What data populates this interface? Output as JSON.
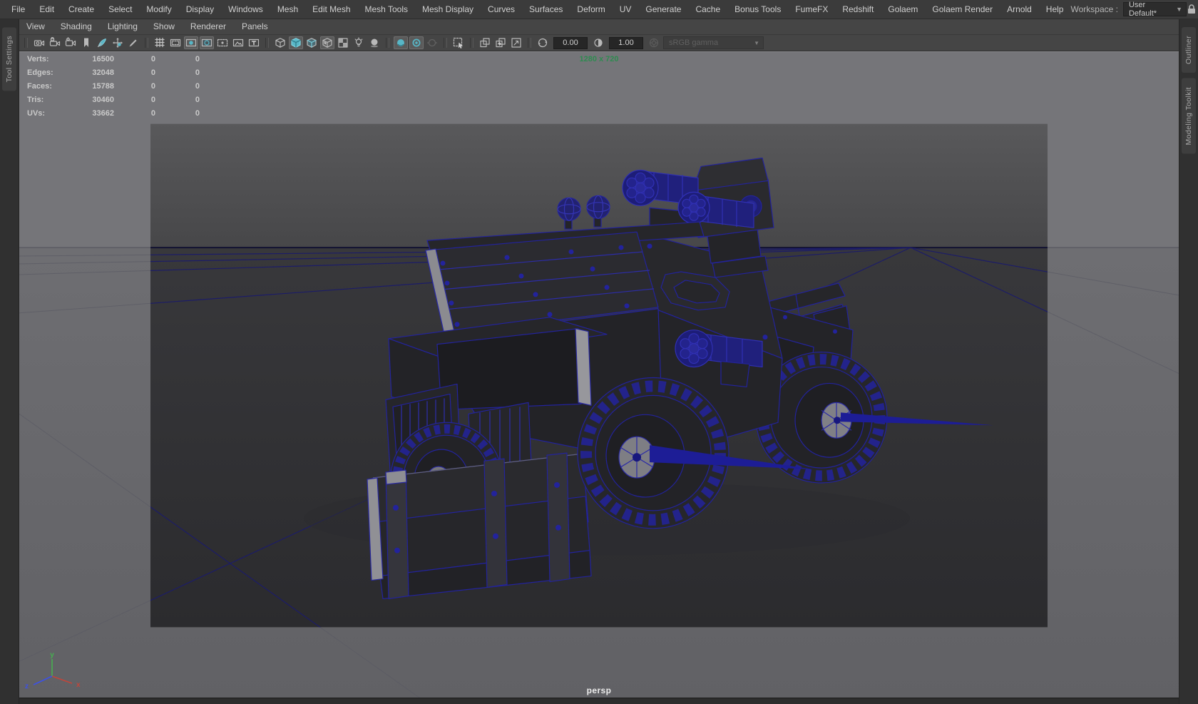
{
  "window": {
    "workspace_label": "Workspace :",
    "workspace_value": "User Default*",
    "lock_icon": "lock-icon"
  },
  "menubar": {
    "items": [
      "File",
      "Edit",
      "Create",
      "Select",
      "Modify",
      "Display",
      "Windows",
      "Mesh",
      "Edit Mesh",
      "Mesh Tools",
      "Mesh Display",
      "Curves",
      "Surfaces",
      "Deform",
      "UV",
      "Generate",
      "Cache",
      "Bonus Tools",
      "FumeFX",
      "Redshift",
      "Golaem",
      "Golaem Render",
      "Arnold",
      "Help"
    ]
  },
  "panel_menus": {
    "items": [
      "View",
      "Shading",
      "Lighting",
      "Show",
      "Renderer",
      "Panels"
    ]
  },
  "toolbar": {
    "icons": [
      {
        "type": "sep"
      },
      {
        "type": "icon",
        "name": "select-camera-icon",
        "kind": "camsel",
        "state": "normal"
      },
      {
        "type": "icon",
        "name": "lock-camera-icon",
        "kind": "camlock",
        "state": "normal"
      },
      {
        "type": "icon",
        "name": "camera-attributes-icon",
        "kind": "camgear",
        "state": "normal"
      },
      {
        "type": "icon",
        "name": "bookmark-icon",
        "kind": "bookmark",
        "state": "normal"
      },
      {
        "type": "icon",
        "name": "image-plane-icon",
        "kind": "quill",
        "state": "normal"
      },
      {
        "type": "icon",
        "name": "pan-zoom-2d-icon",
        "kind": "pan2d",
        "state": "normal"
      },
      {
        "type": "icon",
        "name": "grease-pencil-icon",
        "kind": "pencil",
        "state": "normal"
      },
      {
        "type": "sep"
      },
      {
        "type": "icon",
        "name": "grid-icon",
        "kind": "grid",
        "state": "normal"
      },
      {
        "type": "icon",
        "name": "film-gate-icon",
        "kind": "filmgate",
        "state": "normal"
      },
      {
        "type": "icon",
        "name": "resolution-gate-icon",
        "kind": "resgate",
        "state": "active"
      },
      {
        "type": "icon",
        "name": "gate-mask-icon",
        "kind": "gatemask",
        "state": "active"
      },
      {
        "type": "icon",
        "name": "field-chart-icon",
        "kind": "fieldchart",
        "state": "normal"
      },
      {
        "type": "icon",
        "name": "safe-action-icon",
        "kind": "safeaction",
        "state": "normal"
      },
      {
        "type": "icon",
        "name": "safe-title-icon",
        "kind": "safetitle",
        "state": "normal"
      },
      {
        "type": "sep"
      },
      {
        "type": "icon",
        "name": "wireframe-icon",
        "kind": "cubewire",
        "state": "normal"
      },
      {
        "type": "icon",
        "name": "smooth-shade-icon",
        "kind": "cubeshaded",
        "state": "active"
      },
      {
        "type": "icon",
        "name": "wireframe-on-shaded-icon",
        "kind": "cubehalf",
        "state": "normal"
      },
      {
        "type": "icon",
        "name": "textured-icon",
        "kind": "cubetex",
        "state": "active"
      },
      {
        "type": "icon",
        "name": "use-default-material-icon",
        "kind": "checker",
        "state": "normal"
      },
      {
        "type": "icon",
        "name": "lighting-icon",
        "kind": "bulb",
        "state": "normal"
      },
      {
        "type": "icon",
        "name": "shadows-icon",
        "kind": "sphshadow",
        "state": "normal"
      },
      {
        "type": "sep"
      },
      {
        "type": "icon",
        "name": "ambient-occlusion-icon",
        "kind": "ao",
        "state": "active"
      },
      {
        "type": "icon",
        "name": "anti-aliasing-icon",
        "kind": "aa",
        "state": "active"
      },
      {
        "type": "icon",
        "name": "depth-of-field-icon",
        "kind": "dofdim",
        "state": "dim"
      },
      {
        "type": "sep"
      },
      {
        "type": "icon",
        "name": "isolate-select-icon",
        "kind": "isolate",
        "state": "normal"
      },
      {
        "type": "sep"
      },
      {
        "type": "icon",
        "name": "snapshot-icon",
        "kind": "layers",
        "state": "normal"
      },
      {
        "type": "icon",
        "name": "scene-capture-icon",
        "kind": "layersgo",
        "state": "normal"
      },
      {
        "type": "icon",
        "name": "render-region-icon",
        "kind": "regionarrow",
        "state": "normal"
      },
      {
        "type": "sep"
      },
      {
        "type": "icon",
        "name": "exposure-icon",
        "kind": "aperture",
        "state": "normal"
      },
      {
        "type": "field",
        "name": "exposure-field",
        "value": "0.00"
      },
      {
        "type": "icon",
        "name": "contrast-icon",
        "kind": "contrast",
        "state": "normal"
      },
      {
        "type": "field",
        "name": "gamma-field",
        "value": "1.00"
      },
      {
        "type": "icon",
        "name": "color-management-icon",
        "kind": "cmdim",
        "state": "dim"
      },
      {
        "type": "dropdown",
        "name": "colorspace-select",
        "value": "sRGB gamma"
      }
    ]
  },
  "hud": {
    "rows": [
      {
        "label": "Verts:",
        "total": "16500",
        "sel": "0",
        "sel2": "0"
      },
      {
        "label": "Edges:",
        "total": "32048",
        "sel": "0",
        "sel2": "0"
      },
      {
        "label": "Faces:",
        "total": "15788",
        "sel": "0",
        "sel2": "0"
      },
      {
        "label": "Tris:",
        "total": "30460",
        "sel": "0",
        "sel2": "0"
      },
      {
        "label": "UVs:",
        "total": "33662",
        "sel": "0",
        "sel2": "0"
      }
    ],
    "gate_resolution": "1280 x 720"
  },
  "viewport": {
    "camera_label": "persp"
  },
  "side_tabs": {
    "left": [
      "Tool Settings"
    ],
    "right": [
      "Outliner",
      "Modeling Toolkit"
    ]
  },
  "axis_gizmo": {
    "x": "x",
    "y": "y",
    "z": "z"
  },
  "colors": {
    "accent_teal": "#58b6c6",
    "wire_navy": "#23239c",
    "gate_green": "#2e8b50",
    "axis_x": "#c2453a",
    "axis_y": "#46b050",
    "axis_z": "#3c51e8"
  }
}
